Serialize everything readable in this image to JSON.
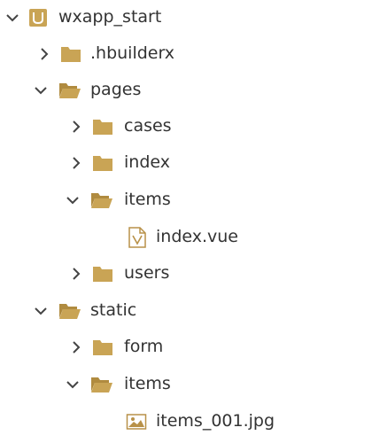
{
  "colors": {
    "folder": "#C9A455",
    "folder_dark": "#B08B3F",
    "chevron": "#444444",
    "text": "#333333",
    "file_icon": "#B89148"
  },
  "tree": {
    "root": {
      "label": "wxapp_start",
      "icon": "project-icon",
      "expanded": true
    },
    "hbuilderx": {
      "label": ".hbuilderx",
      "icon": "folder-icon",
      "expanded": false
    },
    "pages": {
      "label": "pages",
      "icon": "folder-open-icon",
      "expanded": true
    },
    "cases": {
      "label": "cases",
      "icon": "folder-icon",
      "expanded": false
    },
    "index": {
      "label": "index",
      "icon": "folder-icon",
      "expanded": false
    },
    "items_pages": {
      "label": "items",
      "icon": "folder-open-icon",
      "expanded": true
    },
    "index_vue": {
      "label": "index.vue",
      "icon": "vue-file-icon"
    },
    "users": {
      "label": "users",
      "icon": "folder-icon",
      "expanded": false
    },
    "static": {
      "label": "static",
      "icon": "folder-open-icon",
      "expanded": true
    },
    "form": {
      "label": "form",
      "icon": "folder-icon",
      "expanded": false
    },
    "items_static": {
      "label": "items",
      "icon": "folder-open-icon",
      "expanded": true
    },
    "items_jpg": {
      "label": "items_001.jpg",
      "icon": "image-file-icon"
    }
  }
}
